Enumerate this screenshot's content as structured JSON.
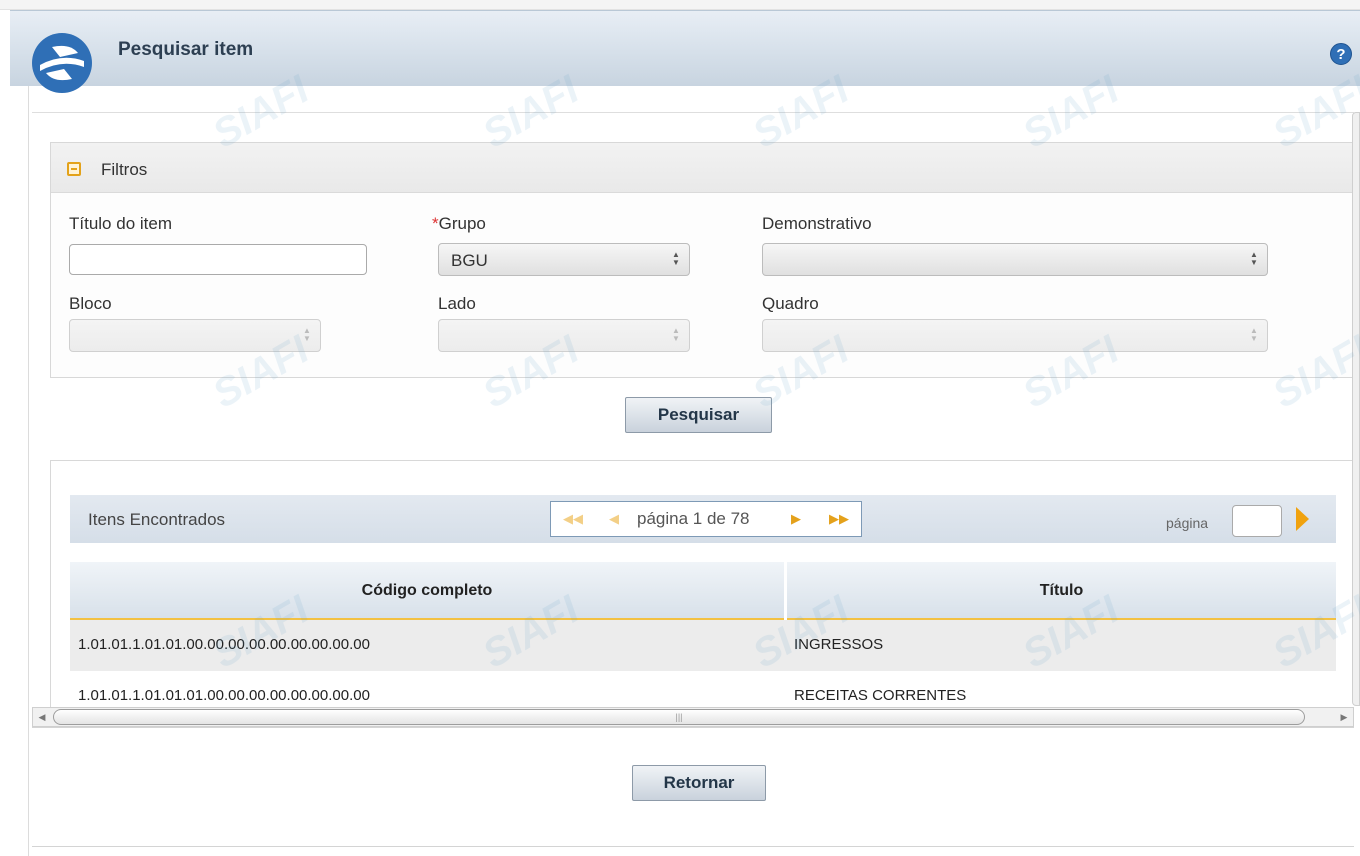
{
  "dialog": {
    "title": "Pesquisar item",
    "help_label": "?"
  },
  "filters": {
    "title": "Filtros",
    "titulo_label": "Título do item",
    "titulo_value": "",
    "grupo_required_mark": "*",
    "grupo_label": "Grupo",
    "grupo_value": "BGU",
    "demonstrativo_label": "Demonstrativo",
    "demonstrativo_value": "",
    "bloco_label": "Bloco",
    "bloco_value": "",
    "lado_label": "Lado",
    "lado_value": "",
    "quadro_label": "Quadro",
    "quadro_value": "",
    "search_button": "Pesquisar"
  },
  "results": {
    "title": "Itens Encontrados",
    "pager_text": "página 1 de 78",
    "go_label": "página",
    "go_value": "",
    "columns": [
      "Código completo",
      "Título"
    ],
    "rows": [
      {
        "codigo": "1.01.01.1.01.01.00.00.00.00.00.00.00.00.00",
        "titulo": "INGRESSOS"
      },
      {
        "codigo": "1.01.01.1.01.01.01.00.00.00.00.00.00.00.00",
        "titulo": "RECEITAS CORRENTES"
      }
    ]
  },
  "footer": {
    "return_button": "Retornar"
  },
  "watermark": {
    "text": "SIAFI"
  },
  "colors": {
    "accent": "#e4a11b",
    "header_bg": "#d6e0ea",
    "title_text": "#2d3f52",
    "help_blue": "#2f6fb6"
  }
}
